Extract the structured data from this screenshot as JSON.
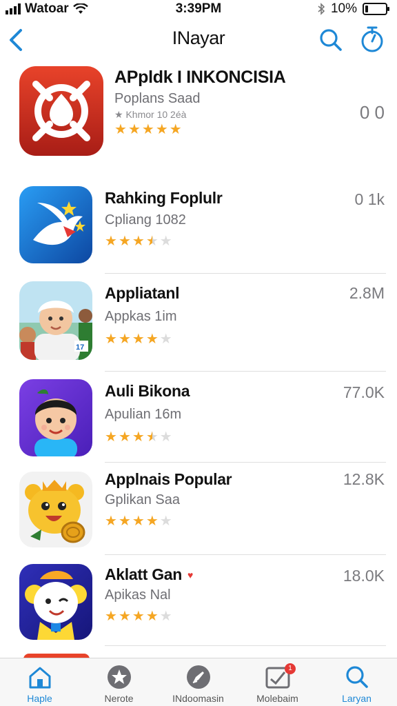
{
  "status_bar": {
    "carrier": "Watoar",
    "time": "3:39PM",
    "battery": "10%",
    "battery_level": 0.15
  },
  "nav": {
    "title": "INayar"
  },
  "apps": [
    {
      "name": "APpldk I INKONCISIA",
      "subtitle": "Poplans Saad",
      "extra": "★ Khmor 10 2éà",
      "rating": 5,
      "count": "0 0"
    },
    {
      "name": "Rahking Foplulr",
      "subtitle": "Cpliang 1082",
      "extra": "",
      "rating": 3.5,
      "count": "0 1k"
    },
    {
      "name": "Appliatanl",
      "subtitle": "Appkas 1im",
      "extra": "",
      "rating": 4,
      "count": "2.8M"
    },
    {
      "name": "Auli Bikona",
      "subtitle": "Apulian 16m",
      "extra": "",
      "rating": 3.5,
      "count": "77.0K"
    },
    {
      "name": "Applnais Popular",
      "subtitle": "Gplikan Saa",
      "extra": "",
      "rating": 4,
      "count": "12.8K"
    },
    {
      "name": "Aklatt Gan",
      "subtitle": "Apikas Nal",
      "extra": "",
      "rating": 4,
      "count": "18.0K"
    }
  ],
  "tabs": [
    {
      "label": "Haple",
      "icon": "home-icon",
      "active": true
    },
    {
      "label": "Nerote",
      "icon": "star-icon",
      "active": false
    },
    {
      "label": "INdoomasin",
      "icon": "rocket-icon",
      "active": false
    },
    {
      "label": "Molebaim",
      "icon": "updates-icon",
      "active": false,
      "badge": "1"
    },
    {
      "label": "Laryan",
      "icon": "search-icon",
      "active": true
    }
  ],
  "colors": {
    "accent": "#1e88d6",
    "star": "#f5a623",
    "badge": "#e53935"
  }
}
